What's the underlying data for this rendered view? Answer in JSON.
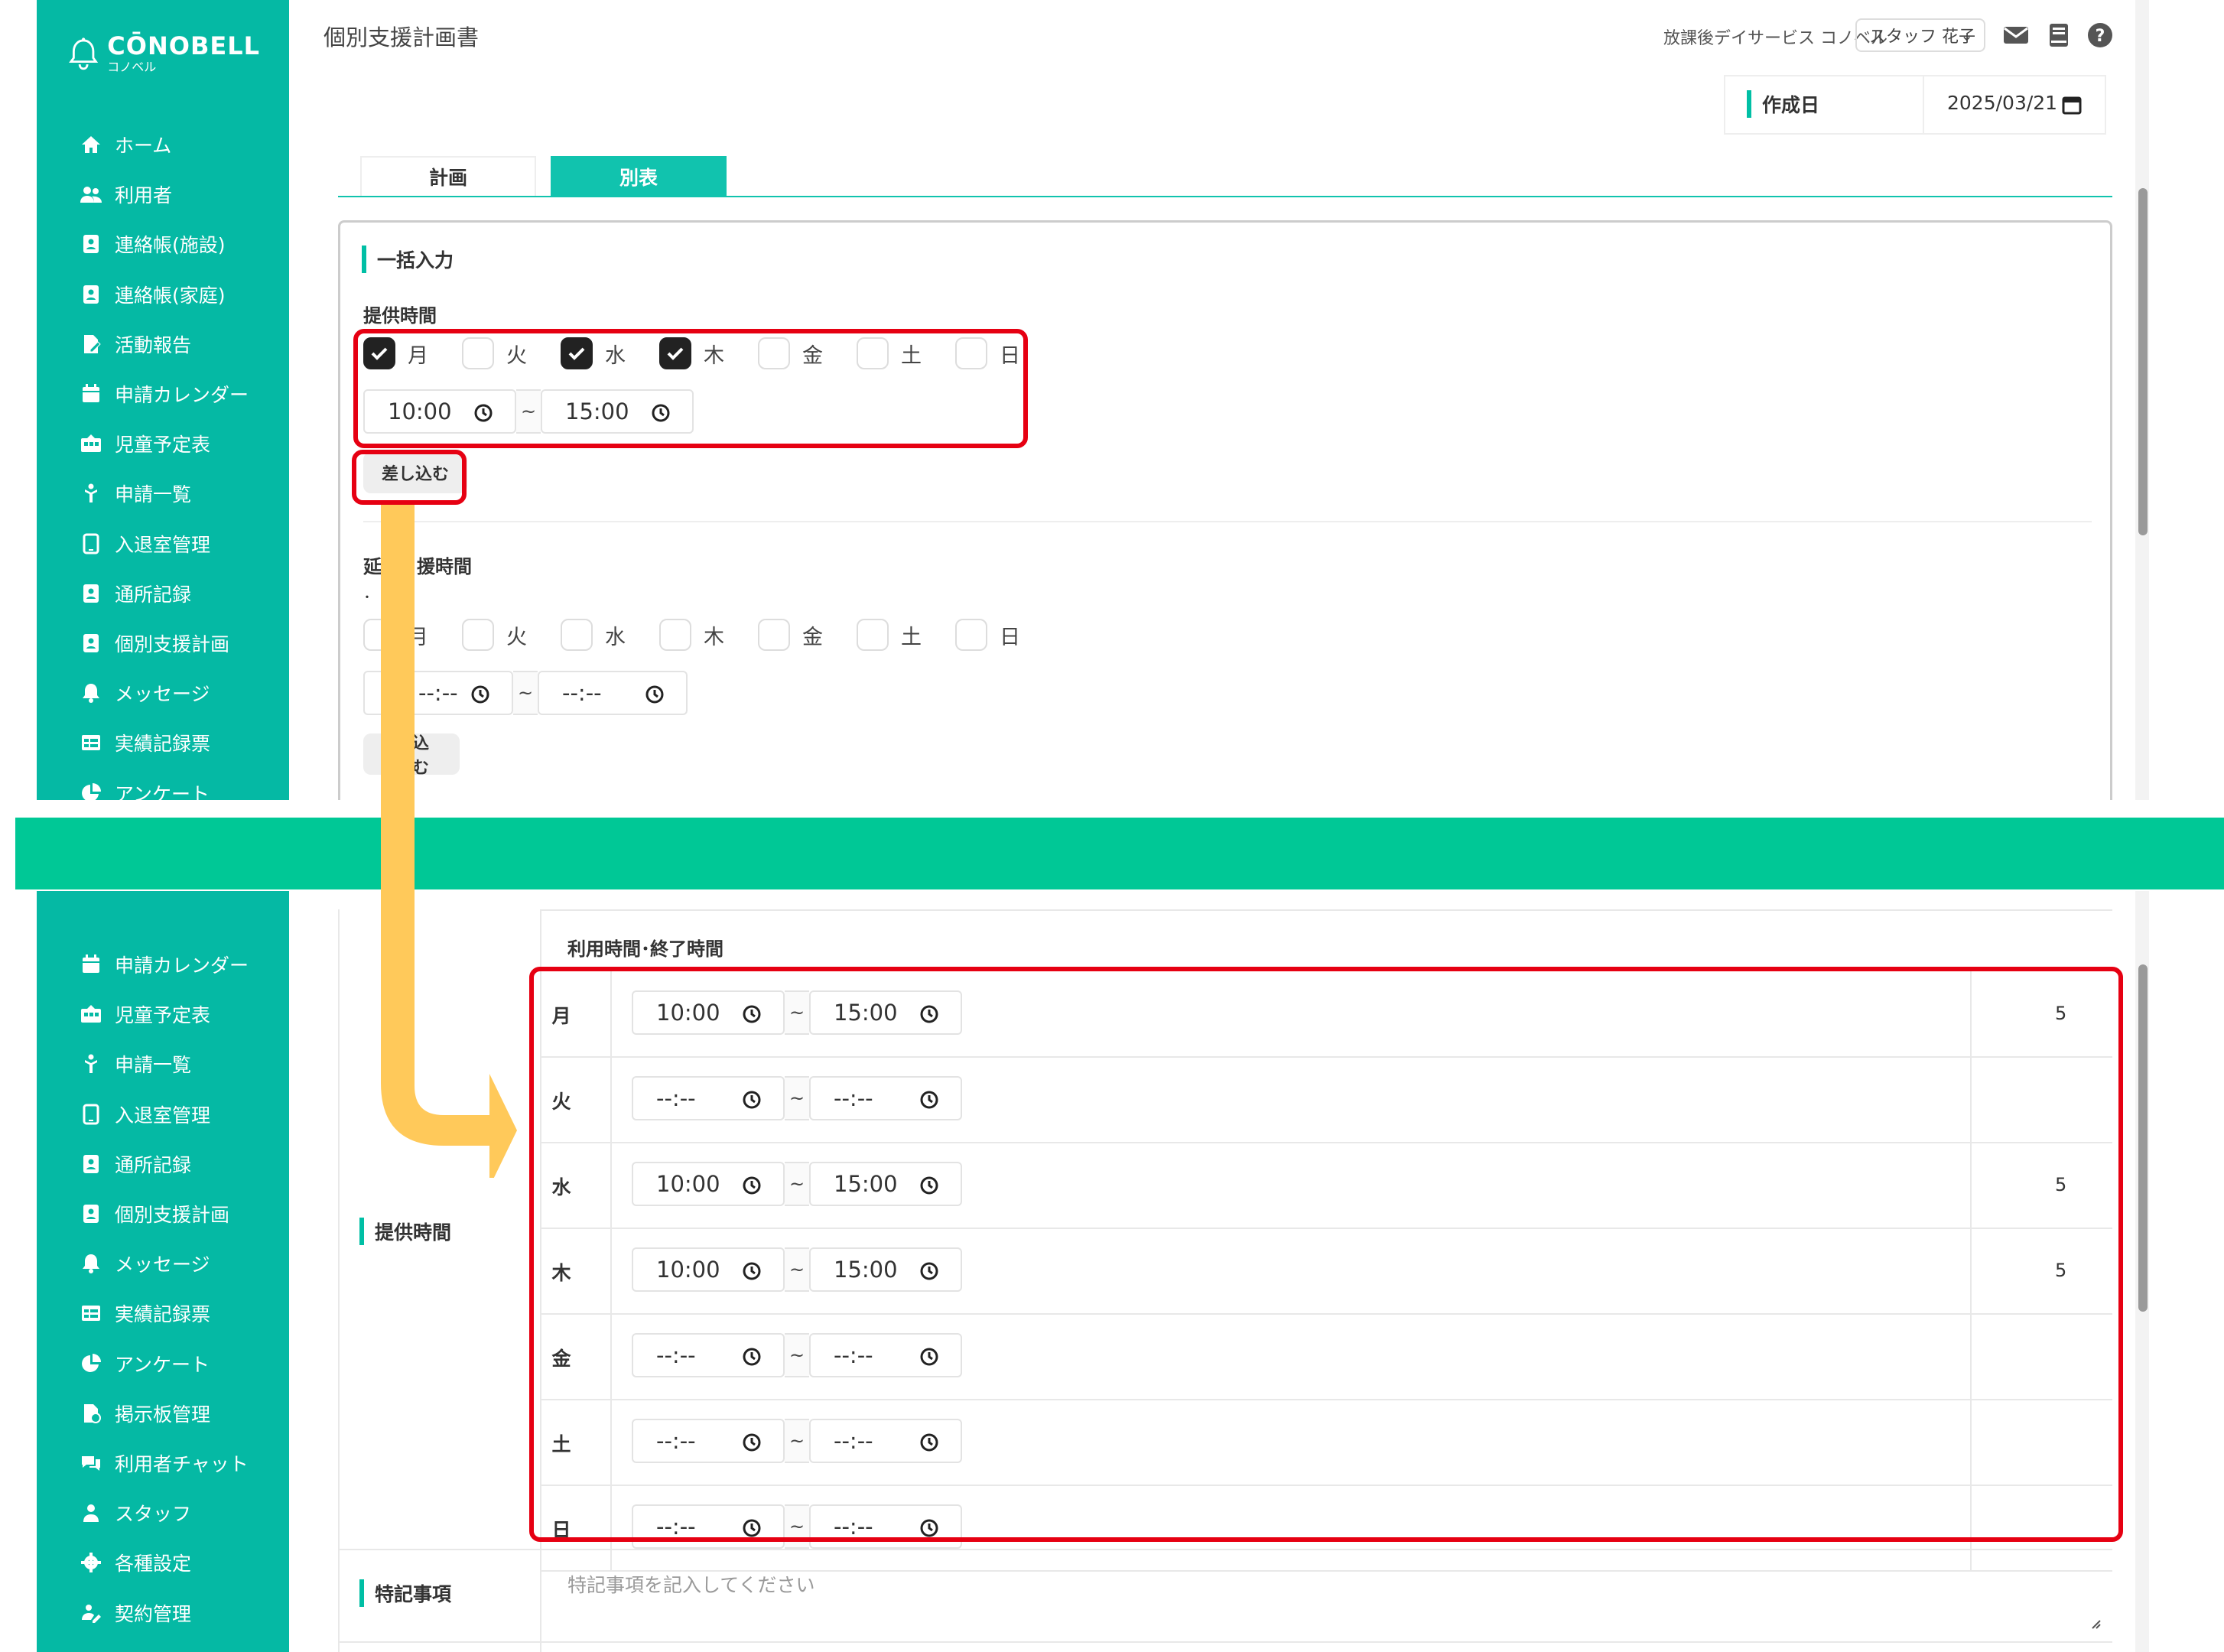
{
  "app": {
    "brand": "CŌNOBELL",
    "brand_sub": "コノベル",
    "page_title": "個別支援計画書",
    "org_name": "放課後デイサービス コノベル",
    "user_name": "スタッフ 花子",
    "user_caret": "⌄"
  },
  "sidebar_top": [
    {
      "label": "ホーム",
      "icon": "home-icon"
    },
    {
      "label": "利用者",
      "icon": "users-icon"
    },
    {
      "label": "連絡帳(施設)",
      "icon": "contact-book-icon"
    },
    {
      "label": "連絡帳(家庭)",
      "icon": "contact-book-icon"
    },
    {
      "label": "活動報告",
      "icon": "report-icon"
    },
    {
      "label": "申請カレンダー",
      "icon": "calendar-icon"
    },
    {
      "label": "児童予定表",
      "icon": "schedule-icon"
    },
    {
      "label": "申請一覧",
      "icon": "request-icon"
    },
    {
      "label": "入退室管理",
      "icon": "tablet-icon"
    },
    {
      "label": "通所記録",
      "icon": "record-icon"
    },
    {
      "label": "個別支援計画",
      "icon": "plan-icon"
    },
    {
      "label": "メッセージ",
      "icon": "bell-icon"
    },
    {
      "label": "実績記録票",
      "icon": "table-icon"
    },
    {
      "label": "アンケート",
      "icon": "pie-icon"
    }
  ],
  "sidebar_bottom": [
    {
      "label": "申請カレンダー",
      "icon": "calendar-icon"
    },
    {
      "label": "児童予定表",
      "icon": "schedule-icon"
    },
    {
      "label": "申請一覧",
      "icon": "request-icon"
    },
    {
      "label": "入退室管理",
      "icon": "tablet-icon"
    },
    {
      "label": "通所記録",
      "icon": "record-icon"
    },
    {
      "label": "個別支援計画",
      "icon": "plan-icon"
    },
    {
      "label": "メッセージ",
      "icon": "bell-icon"
    },
    {
      "label": "実績記録票",
      "icon": "table-icon"
    },
    {
      "label": "アンケート",
      "icon": "pie-icon"
    },
    {
      "label": "掲示板管理",
      "icon": "board-icon"
    },
    {
      "label": "利用者チャット",
      "icon": "chat-icon"
    },
    {
      "label": "スタッフ",
      "icon": "staff-icon"
    },
    {
      "label": "各種設定",
      "icon": "gear-icon"
    },
    {
      "label": "契約管理",
      "icon": "contract-icon"
    }
  ],
  "date": {
    "label": "作成日",
    "value": "2025/03/21"
  },
  "tabs": {
    "plan": "計画",
    "appendix": "別表"
  },
  "bulk": {
    "title": "一括入力",
    "provide_label": "提供時間",
    "days": [
      {
        "label": "月",
        "checked": true
      },
      {
        "label": "火",
        "checked": false
      },
      {
        "label": "水",
        "checked": true
      },
      {
        "label": "木",
        "checked": true
      },
      {
        "label": "金",
        "checked": false
      },
      {
        "label": "土",
        "checked": false
      },
      {
        "label": "日",
        "checked": false
      }
    ],
    "start": "10:00",
    "end": "15:00",
    "tilde": "~",
    "apply_label": "差し込む"
  },
  "extended": {
    "title_a": "延",
    "title_b": "援時間",
    "sub_a": "･",
    "sub_b": "前",
    "days": [
      "月",
      "火",
      "水",
      "木",
      "金",
      "土",
      "日"
    ],
    "start": "--:--",
    "end": "--:--",
    "apply_label_tail": "込む"
  },
  "schedule": {
    "row_label": "提供時間",
    "header": "利用時間･終了時間",
    "rows": [
      {
        "day": "月",
        "start": "10:00",
        "end": "15:00",
        "hours": "5"
      },
      {
        "day": "火",
        "start": "--:--",
        "end": "--:--",
        "hours": ""
      },
      {
        "day": "水",
        "start": "10:00",
        "end": "15:00",
        "hours": "5"
      },
      {
        "day": "木",
        "start": "10:00",
        "end": "15:00",
        "hours": "5"
      },
      {
        "day": "金",
        "start": "--:--",
        "end": "--:--",
        "hours": ""
      },
      {
        "day": "土",
        "start": "--:--",
        "end": "--:--",
        "hours": ""
      },
      {
        "day": "日",
        "start": "--:--",
        "end": "--:--",
        "hours": ""
      }
    ],
    "tilde": "~"
  },
  "notes": {
    "label": "特記事項",
    "placeholder": "特記事項を記入してください"
  },
  "colors": {
    "brand": "#05b9a4",
    "divider": "#00c896",
    "highlight": "#e60012",
    "arrow": "#ffc95a"
  }
}
